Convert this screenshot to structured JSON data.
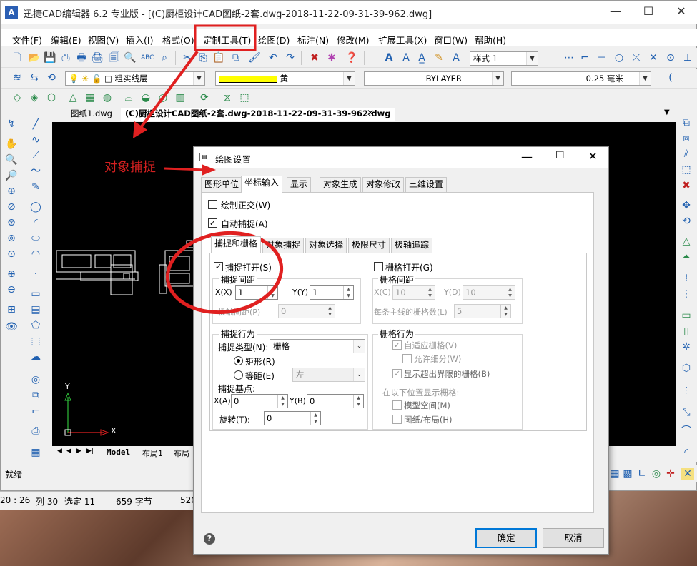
{
  "app": {
    "title": "迅捷CAD编辑器 6.2 专业版  - [(C)厨柜设计CAD图纸-2套.dwg-2018-11-22-09-31-39-962.dwg]",
    "icon_label": "A"
  },
  "menu": [
    "文件(F)",
    "编辑(E)",
    "视图(V)",
    "插入(I)",
    "格式(O)",
    "定制工具(T)",
    "绘图(D)",
    "标注(N)",
    "修改(M)",
    "扩展工具(X)",
    "窗口(W)",
    "帮助(H)"
  ],
  "toolbar": {
    "style_combo": "样式 1",
    "layer_combo": "粗实线层",
    "color_combo": "黄",
    "color_hex": "#ffff00",
    "linetype_combo": "BYLAYER",
    "lineweight_combo": "0.25 毫米"
  },
  "doc_tabs": [
    "图纸1.dwg",
    "(C)厨柜设计CAD图纸-2套.dwg-2018-11-22-09-31-39-962.dwg"
  ],
  "sheet_tabs": [
    "Model",
    "布局1",
    "布局"
  ],
  "ucs": {
    "y_label": "Y",
    "x_label": "X"
  },
  "status": {
    "ready": "就绪",
    "coords": "20 : 26",
    "col": "列 30",
    "selected": "选定 11",
    "bytes": "659 字节",
    "extra": "520"
  },
  "annotation": {
    "label": "对象捕捉",
    "color": "#d42020"
  },
  "dialog": {
    "title": "绘图设置",
    "tabs": [
      "图形单位",
      "坐标输入",
      "显示",
      "对象生成",
      "对象修改",
      "三维设置"
    ],
    "selected_tab": "坐标输入",
    "ortho_label": "绘制正交(W)",
    "ortho_checked": false,
    "autosnap_label": "自动捕捉(A)",
    "autosnap_checked": true,
    "sub_tabs": [
      "捕捉和栅格",
      "对象捕捉",
      "对象选择",
      "极限尺寸",
      "极轴追踪"
    ],
    "selected_sub_tab": "捕捉和栅格",
    "snap_on_label": "捕捉打开(S)",
    "snap_on_checked": true,
    "snap_spacing_title": "捕捉间距",
    "snap_x_label": "X(X)",
    "snap_x_value": "1",
    "snap_y_label": "Y(Y)",
    "snap_y_value": "1",
    "polar_distance_label": "极轴间距(P)",
    "polar_distance_value": "0",
    "grid_on_label": "栅格打开(G)",
    "grid_on_checked": false,
    "grid_spacing_title": "栅格间距",
    "grid_x_label": "X(C)",
    "grid_x_value": "10",
    "grid_y_label": "Y(D)",
    "grid_y_value": "10",
    "major_line_label": "每条主线的栅格数(L)",
    "major_line_value": "5",
    "snap_behavior_title": "捕捉行为",
    "snap_type_label": "捕捉类型(N):",
    "snap_type_value": "栅格",
    "rect_label": "矩形(R)",
    "iso_label": "等距(E)",
    "iso_value": "左",
    "base_point_title": "捕捉基点:",
    "base_x_label": "X(A)",
    "base_x_value": "0",
    "base_y_label": "Y(B)",
    "base_y_value": "0",
    "rotation_label": "旋转(T):",
    "rotation_value": "0",
    "grid_behavior_title": "栅格行为",
    "adaptive_label": "自适应栅格(V)",
    "subdivide_label": "允许细分(W)",
    "beyond_limits_label": "显示超出界限的栅格(B)",
    "display_at_title": "在以下位置显示栅格:",
    "model_space_label": "模型空间(M)",
    "paper_layout_label": "图纸/布局(H)",
    "ok_label": "确定",
    "cancel_label": "取消",
    "help_icon": "?"
  }
}
